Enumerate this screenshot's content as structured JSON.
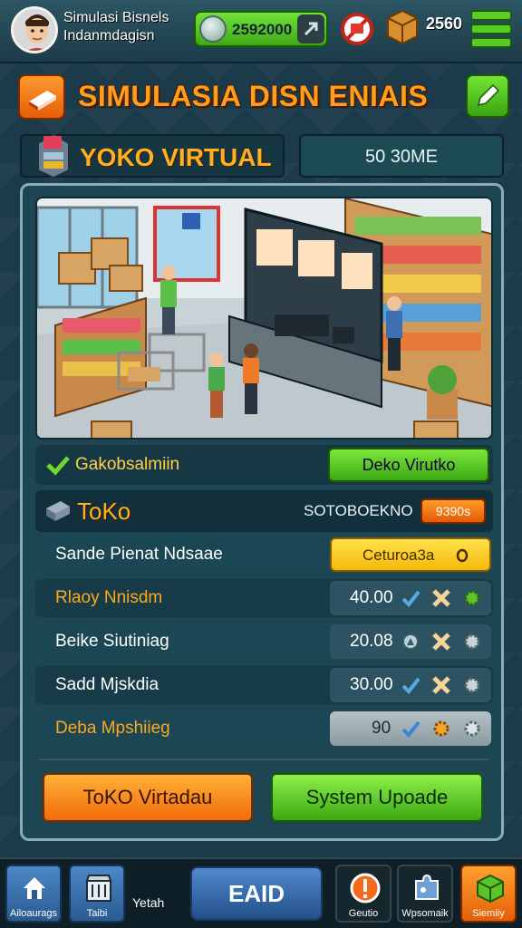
{
  "header": {
    "player_name": "Simulasi Bisnels Indanmdagisn",
    "money": "2592000",
    "item_count": "2560"
  },
  "title": {
    "text": "SIMULASIA DISN ENIAIS"
  },
  "store": {
    "name": "YOKO VIRTUAL",
    "score_label": "50 30ME"
  },
  "status": {
    "label": "Gakobsalmiin",
    "button": "Deko Virutko"
  },
  "toko": {
    "title": "ToKo",
    "subtitle": "SOTOBOEKNO",
    "badge": "9390s"
  },
  "rows": [
    {
      "name": "Sande Pienat Ndsaae",
      "value": "Ceturoa3a"
    },
    {
      "name": "Rlaoy Nnisdm",
      "value": "40.00"
    },
    {
      "name": "Beike Siutiniag",
      "value": "20.08"
    },
    {
      "name": "Sadd Mjskdia",
      "value": "30.00"
    },
    {
      "name": "Deba Mpshiieg",
      "value": "90"
    }
  ],
  "actions": {
    "primary": "ToKO Virtadau",
    "secondary": "System Upoade"
  },
  "nav": {
    "home": "Ailoaurags",
    "shop": "Taibi",
    "shop_side": "Yetah",
    "main": "EAID",
    "alert": "Geutio",
    "puzzle": "Wpsomaik",
    "green": "Siemiiy"
  },
  "colors": {
    "accent_orange": "#ff9d1e",
    "accent_green": "#4fc41c",
    "panel": "#1e4652"
  }
}
